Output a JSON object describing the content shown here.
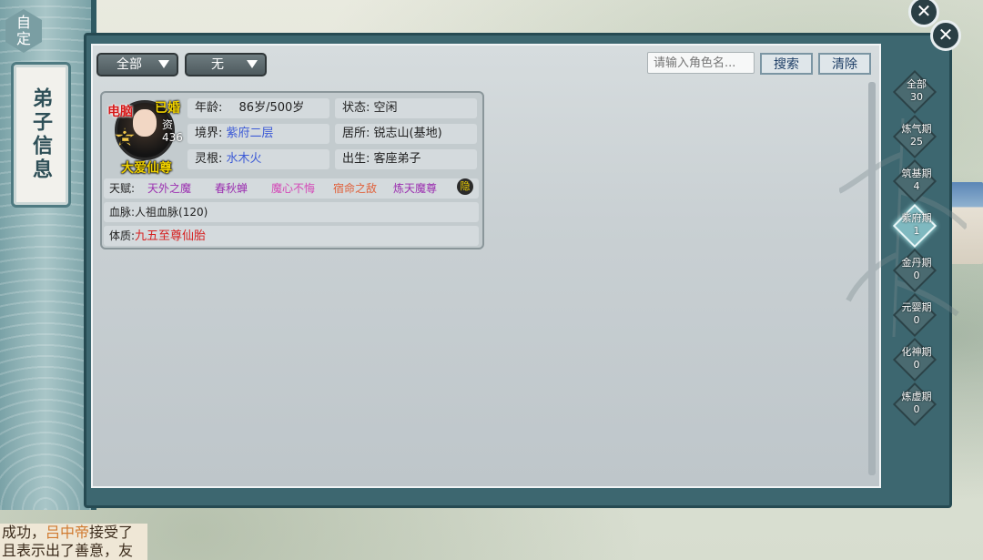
{
  "background": {
    "bottom_text_line1_a": "成功，",
    "bottom_text_line1_name": "吕中帝",
    "bottom_text_line1_b": "接受了",
    "bottom_text_line2": "且表示出了善意，友"
  },
  "left_sidebar": {
    "custom_tag": "自定",
    "title": "弟子信息"
  },
  "toolbar": {
    "filter1": "全部",
    "filter2": "无",
    "search_placeholder": "请输入角色名...",
    "search_label": "搜索",
    "clear_label": "清除"
  },
  "disciple": {
    "badge_left": "电脑",
    "badge_married": "已婚",
    "aptitude_label": "资",
    "aptitude_value": "436",
    "rank_glyph": "名",
    "title": "大爱仙尊",
    "age_label": "年龄:",
    "age_value": "86岁/500岁",
    "status_label": "状态:",
    "status_value": "空闲",
    "realm_label": "境界:",
    "realm_value": "紫府二层",
    "residence_label": "居所:",
    "residence_value": "锐志山(基地)",
    "root_label": "灵根:",
    "root_value": "水木火",
    "origin_label": "出生:",
    "origin_value": "客座弟子",
    "talent_label": "天赋:",
    "talents": [
      {
        "text": "天外之魔",
        "color": "#9b2fb0"
      },
      {
        "text": "春秋蝉",
        "color": "#9b2fb0"
      },
      {
        "text": "魔心不悔",
        "color": "#d447b7"
      },
      {
        "text": "宿命之敌",
        "color": "#e0603a"
      },
      {
        "text": "炼天魔尊",
        "color": "#9b2fb0"
      }
    ],
    "hidden_icon": "隐",
    "bloodline_label": "血脉:",
    "bloodline_value": "人祖血脉(120)",
    "physique_label": "体质:",
    "physique_value": "九五至尊仙胎",
    "physique_color": "#d62020"
  },
  "realms": [
    {
      "name": "全部",
      "count": "30",
      "active": false
    },
    {
      "name": "炼气期",
      "count": "25",
      "active": false
    },
    {
      "name": "筑基期",
      "count": "4",
      "active": false
    },
    {
      "name": "紫府期",
      "count": "1",
      "active": true
    },
    {
      "name": "金丹期",
      "count": "0",
      "active": false
    },
    {
      "name": "元婴期",
      "count": "0",
      "active": false
    },
    {
      "name": "化神期",
      "count": "0",
      "active": false
    },
    {
      "name": "炼虚期",
      "count": "0",
      "active": false
    }
  ],
  "close_icon": "✕"
}
